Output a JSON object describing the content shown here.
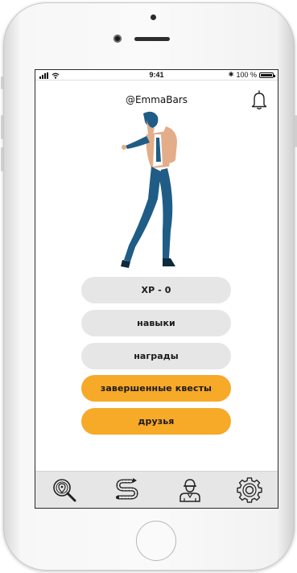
{
  "statusbar": {
    "time": "9:41",
    "battery_text": "100 %",
    "battery_level": 1.0,
    "bluetooth_symbol": "✱"
  },
  "profile": {
    "username": "@EmmaBars"
  },
  "menu": {
    "xp_label": "XP - 0",
    "skills_label": "навыки",
    "rewards_label": "награды",
    "completed_quests_label": "завершенные квесты",
    "friends_label": "друзья"
  },
  "tabbar": {
    "items": [
      {
        "icon": "map-search-icon"
      },
      {
        "icon": "route-icon"
      },
      {
        "icon": "profile-icon"
      },
      {
        "icon": "settings-gear-icon"
      }
    ]
  },
  "colors": {
    "accent_orange": "#f7a928",
    "button_gray": "#e6e6e6",
    "tabbar_bg": "#e6e6e6",
    "figure_blue": "#1f5d86",
    "figure_skin": "#e3ad8a"
  }
}
